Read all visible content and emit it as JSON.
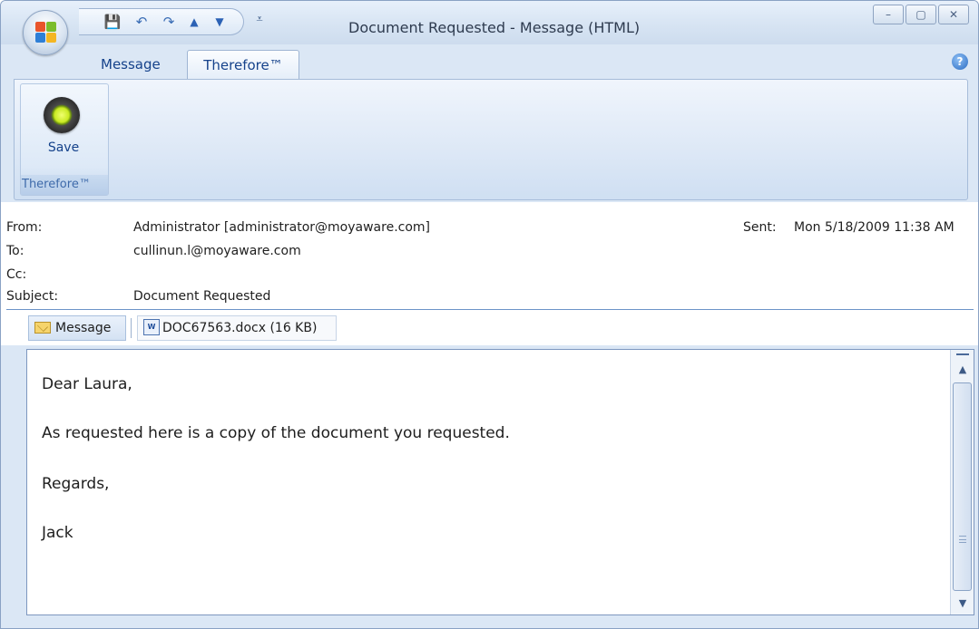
{
  "window": {
    "title": "Document Requested - Message (HTML)",
    "controls": {
      "minimize": "–",
      "maximize": "▢",
      "close": "✕"
    }
  },
  "quick_access": [
    {
      "name": "save-icon",
      "glyph": "💾"
    },
    {
      "name": "undo-icon",
      "glyph": "↶"
    },
    {
      "name": "redo-icon",
      "glyph": "↷"
    },
    {
      "name": "up-arrow-icon",
      "glyph": "▲"
    },
    {
      "name": "down-arrow-icon",
      "glyph": "▼"
    }
  ],
  "quick_access_dropdown": "⩡",
  "tabs": {
    "message": "Message",
    "therefore": "Therefore™"
  },
  "help_icon": "?",
  "ribbon": {
    "save_label": "Save",
    "group_label": "Therefore™"
  },
  "header": {
    "from_label": "From:",
    "from_value": "Administrator [administrator@moyaware.com]",
    "to_label": "To:",
    "to_value": "cullinun.l@moyaware.com",
    "cc_label": "Cc:",
    "cc_value": "",
    "subject_label": "Subject:",
    "subject_value": "Document Requested",
    "sent_label": "Sent:",
    "sent_value": "Mon 5/18/2009 11:38 AM"
  },
  "attachments": {
    "message_label": "Message",
    "doc_label": "DOC67563.docx (16 KB)",
    "doc_icon_text": "W"
  },
  "body": {
    "lines": [
      "Dear Laura,",
      "As requested here is a copy of the document you requested.",
      "Regards,",
      "Jack"
    ]
  },
  "colors": {
    "accent": "#15428b",
    "ribbon_bg": "#dde8f6",
    "border": "#8aa2c4"
  }
}
